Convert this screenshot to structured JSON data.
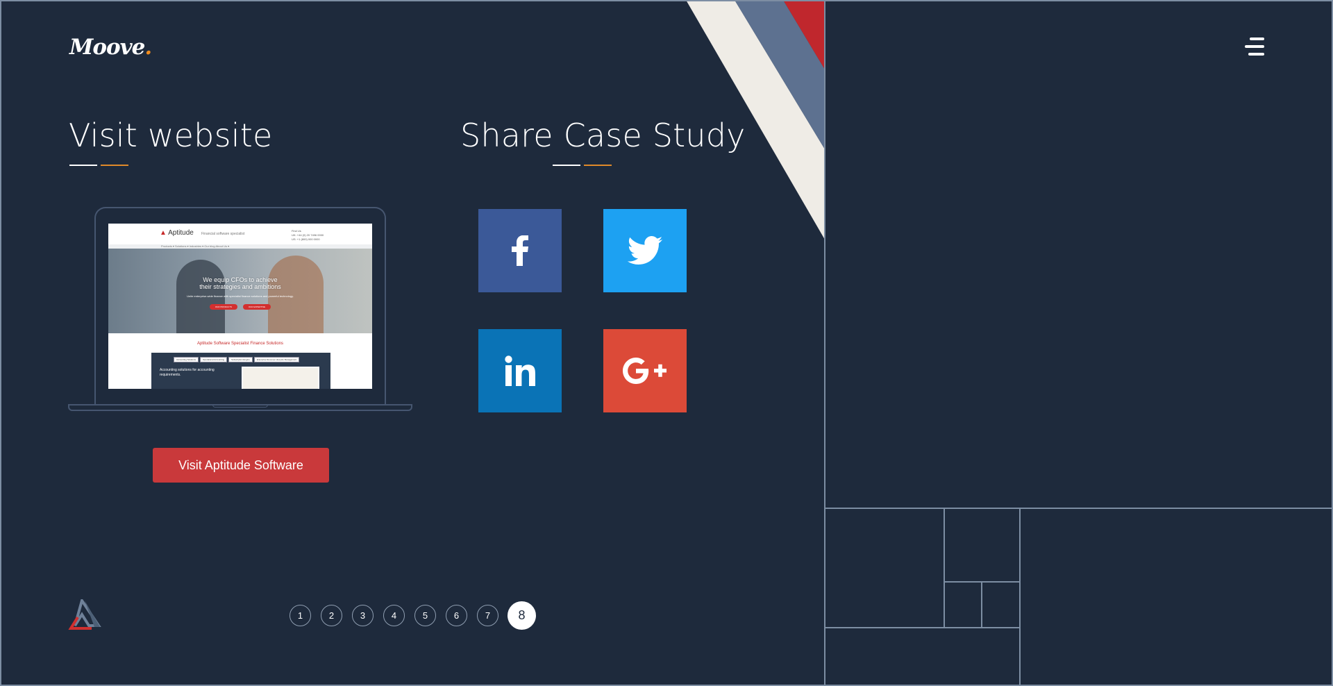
{
  "brand": {
    "logo_text": "Moove",
    "logo_dot": ".",
    "accent": "#f08c1e"
  },
  "header": {
    "menu_icon": "hamburger-icon"
  },
  "visit_section": {
    "title": "Visit website",
    "button_label": "Visit Aptitude Software",
    "preview": {
      "logo": "Aptitude",
      "tagline": "Financial software specialist",
      "contact_lines": [
        "Find Us",
        "UK: +44 (0) 20 7496 0000",
        "US: +1 (800) 000 0000"
      ],
      "nav": "Products ▾   Solutions ▾   Industries ▾   Our blog   About Us ▾",
      "hero_title_1": "We equip CFOs to achieve",
      "hero_title_2": "their strategies and ambitions",
      "hero_sub": "Unite enterprise-wide finance with specialist finance solutions and powerful technology.",
      "hero_btn_1": "OUR PRODUCTS",
      "hero_btn_2": "OUR EXPERTISE",
      "subtitle": "Aptitude Software Specialist Finance Solutions",
      "tabs": [
        "Accounting Solutions",
        "Operational Accounting",
        "Subscription Engine",
        "Enterprise Revenue Lifecycle Management"
      ],
      "panel_text": "Accounting solutions for accounting requirements."
    }
  },
  "share_section": {
    "title": "Share Case Study",
    "buttons": [
      {
        "network": "facebook",
        "icon": "facebook-icon",
        "color": "#3b5998"
      },
      {
        "network": "twitter",
        "icon": "twitter-icon",
        "color": "#1da1f2"
      },
      {
        "network": "linkedin",
        "icon": "linkedin-icon",
        "color": "#0a73b6"
      },
      {
        "network": "google-plus",
        "icon": "google-plus-icon",
        "color": "#dc4a38"
      }
    ]
  },
  "pagination": {
    "pages": [
      "1",
      "2",
      "3",
      "4",
      "5",
      "6",
      "7",
      "8"
    ],
    "current": "8"
  },
  "colors": {
    "background": "#1e2a3c",
    "stripe_cream": "#efece6",
    "stripe_blue": "#5d7190",
    "stripe_red": "#c0272d",
    "button_red": "#c9393b"
  }
}
